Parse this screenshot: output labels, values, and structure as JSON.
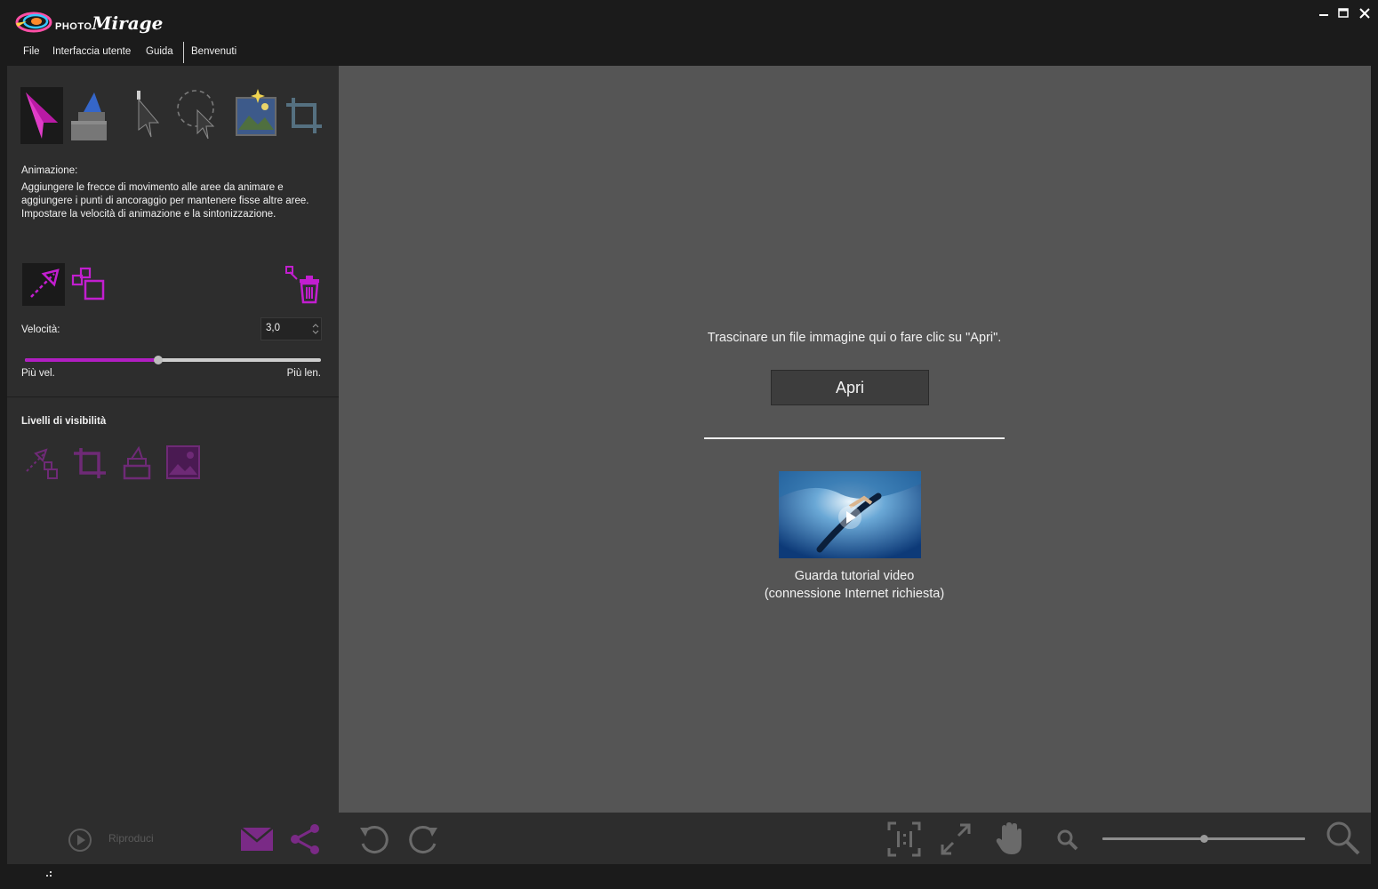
{
  "app": {
    "brand_small": "PHOTO",
    "brand_big": "Mirage",
    "window_controls": {
      "minimize": "▬",
      "maximize": "□",
      "close": "✕"
    }
  },
  "menu": {
    "items": [
      "File",
      "Interfaccia utente",
      "Guida",
      "Benvenuti"
    ]
  },
  "tools": {
    "items": [
      {
        "name": "animation-tool",
        "icon": "animation-arrow-icon",
        "active": true
      },
      {
        "name": "mask-tool",
        "icon": "mask-marker-icon",
        "active": false
      },
      {
        "name": "selection-tool",
        "icon": "pointer-icon",
        "active": false
      },
      {
        "name": "lasso-tool",
        "icon": "lasso-icon",
        "active": false
      },
      {
        "name": "enhance-tool",
        "icon": "image-enhance-icon",
        "active": false
      },
      {
        "name": "crop-tool",
        "icon": "crop-icon",
        "active": false
      }
    ]
  },
  "panel": {
    "description_title": "Animazione:",
    "description_body": "Aggiungere le frecce di movimento alle aree da animare e aggiungere i punti di ancoraggio per mantenere fisse altre aree. Impostare la velocità di animazione e la sintonizzazione.",
    "speed_label": "Velocità:",
    "speed_value": "3,0",
    "speed_fraction": 0.45,
    "speed_min_label": "Più vel.",
    "speed_max_label": "Più len.",
    "visibility_title": "Livelli di visibilità"
  },
  "canvas": {
    "drop_text": "Trascinare un file immagine qui o fare clic su \"Apri\".",
    "open_label": "Apri",
    "video_label_line1": "Guarda tutorial video",
    "video_label_line2": "(connessione Internet richiesta)"
  },
  "bottom": {
    "play_label": "Riproduci",
    "zoom_fraction": 0.5
  },
  "colors": {
    "accent": "#b11ec2",
    "panel": "#2d2d2d",
    "canvas": "#555555",
    "frame": "#1b1b1b"
  }
}
